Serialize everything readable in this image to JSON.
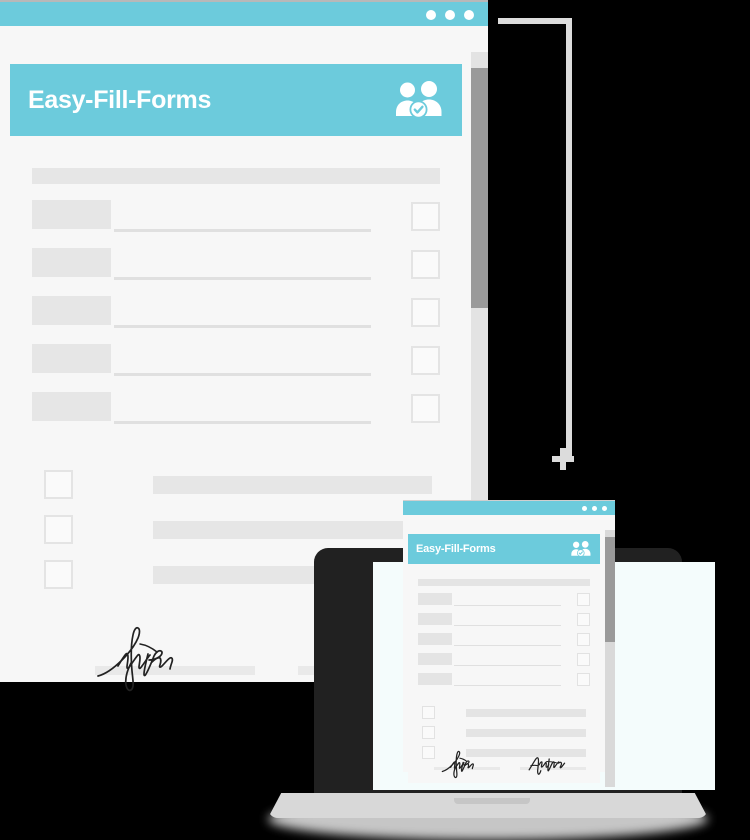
{
  "scene": {
    "background_color": "#000000",
    "accent_color": "#6ccbdc",
    "surface_color": "#f7f7f7",
    "placeholder_color": "#e6e6e6",
    "laptop_frame_color": "#212121"
  },
  "connector": {
    "line_color": "#dcdcdc",
    "cursor_icon": "plus-crosshair-cursor"
  },
  "main_window": {
    "titlebar": {
      "dots": [
        "window-dot-1",
        "window-dot-2",
        "window-dot-3"
      ],
      "color": "#6ccbdc"
    },
    "header": {
      "title": "Easy-Fill-Forms",
      "icon": "two-people-verified-icon"
    },
    "scrollbar": {
      "track_color": "#e3e3e3",
      "thumb_color": "#9a9a9a"
    },
    "document": {
      "top_block": "",
      "field_rows": [
        {
          "label": "",
          "value": "",
          "checkbox": "unchecked"
        },
        {
          "label": "",
          "value": "",
          "checkbox": "unchecked"
        },
        {
          "label": "",
          "value": "",
          "checkbox": "unchecked"
        },
        {
          "label": "",
          "value": "",
          "checkbox": "unchecked"
        },
        {
          "label": "",
          "value": "",
          "checkbox": "unchecked"
        }
      ],
      "consent_rows": [
        {
          "checkbox": "unchecked",
          "text": ""
        },
        {
          "checkbox": "unchecked",
          "text": ""
        },
        {
          "checkbox": "unchecked",
          "text": ""
        }
      ],
      "signatures": [
        {
          "name": "signature-left",
          "ink": "handwritten-signature"
        },
        {
          "name": "signature-right",
          "ink": "handwritten-signature"
        }
      ]
    }
  },
  "laptop": {
    "name": "laptop-device",
    "screen_color": "#f4fcfc",
    "frame_color": "#212121",
    "base_color": "#d8d8d8"
  },
  "small_window": {
    "titlebar": {
      "dots": [
        "window-dot-1",
        "window-dot-2",
        "window-dot-3"
      ],
      "color": "#6ccbdc"
    },
    "header": {
      "title": "Easy-Fill-Forms",
      "icon": "two-people-verified-icon"
    },
    "scrollbar": {
      "track_color": "#d9d9d9",
      "thumb_color": "#9a9a9a"
    },
    "document": {
      "field_rows": [
        {
          "label": "",
          "value": "",
          "checkbox": "unchecked"
        },
        {
          "label": "",
          "value": "",
          "checkbox": "unchecked"
        },
        {
          "label": "",
          "value": "",
          "checkbox": "unchecked"
        },
        {
          "label": "",
          "value": "",
          "checkbox": "unchecked"
        },
        {
          "label": "",
          "value": "",
          "checkbox": "unchecked"
        }
      ],
      "consent_rows": [
        {
          "checkbox": "unchecked",
          "text": ""
        },
        {
          "checkbox": "unchecked",
          "text": ""
        },
        {
          "checkbox": "unchecked",
          "text": ""
        }
      ],
      "signatures": [
        {
          "name": "signature-left",
          "ink": "handwritten-signature"
        },
        {
          "name": "signature-right",
          "ink": "handwritten-signature"
        }
      ]
    }
  }
}
